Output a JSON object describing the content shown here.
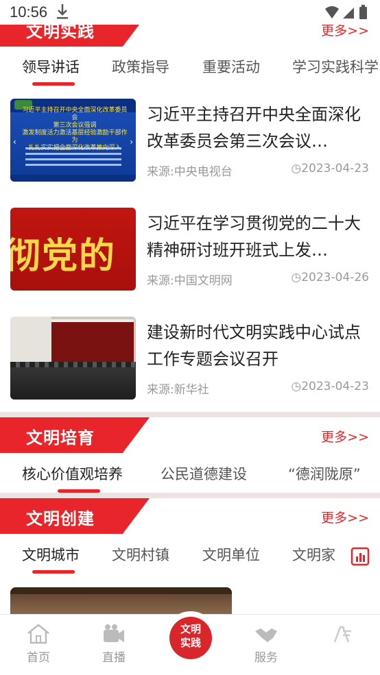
{
  "status": {
    "time": "10:56"
  },
  "practice": {
    "title": "文明实践",
    "more": "更多>>",
    "tabs": [
      "领导讲话",
      "政策指导",
      "重要活动",
      "学习实践科学"
    ],
    "news": [
      {
        "title": "习近平主持召开中央全面深化改革委员会第三次会议…",
        "source": "来源:中央电视台",
        "date": "2023-04-23",
        "thumb_text": [
          "习近平主持召开中央全面深化改革委员会",
          "第三次会议强调",
          "激发制度活力激活基层经验激励干部作为",
          "扎扎实实把全面深化改革推向深入"
        ]
      },
      {
        "title": "习近平在学习贯彻党的二十大精神研讨班开班式上发…",
        "source": "来源:中国文明网",
        "date": "2023-04-26",
        "thumb_text": [
          "彻党的"
        ]
      },
      {
        "title": "建设新时代文明实践中心试点工作专题会议召开",
        "source": "来源:新华社",
        "date": "2023-04-23"
      }
    ]
  },
  "cultivation": {
    "title": "文明培育",
    "more": "更多>>",
    "tabs": [
      "核心价值观培养",
      "公民道德建设",
      "“德润陇原”"
    ]
  },
  "creation": {
    "title": "文明创建",
    "more": "更多>>",
    "tabs": [
      "文明城市",
      "文明村镇",
      "文明单位",
      "文明家"
    ]
  },
  "nav": {
    "items": [
      {
        "label": "首页",
        "icon": "home-icon"
      },
      {
        "label": "直播",
        "icon": "video-camera-icon"
      },
      {
        "label": "",
        "icon": "center-logo"
      },
      {
        "label": "服务",
        "icon": "handshake-icon"
      },
      {
        "label": "",
        "icon": "profile-icon"
      }
    ],
    "center_text": [
      "文明",
      "实践"
    ]
  },
  "colors": {
    "accent": "#e8252b",
    "muted": "#999999"
  }
}
